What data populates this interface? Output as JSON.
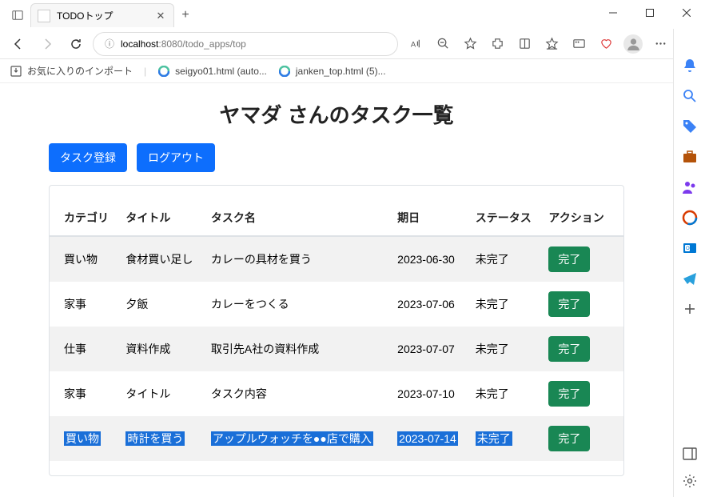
{
  "browser": {
    "tab_title": "TODOトップ",
    "url_host": "localhost",
    "url_port": ":8080",
    "url_path": "/todo_apps/top",
    "bookmarks": {
      "import": "お気に入りのインポート",
      "b1": "seigyo01.html (auto...",
      "b2": "janken_top.html (5)..."
    }
  },
  "page": {
    "title": "ヤマダ さんのタスク一覧",
    "register_btn": "タスク登録",
    "logout_btn": "ログアウト",
    "headers": {
      "category": "カテゴリ",
      "title": "タイトル",
      "task_name": "タスク名",
      "due": "期日",
      "status": "ステータス",
      "action": "アクション"
    },
    "complete_btn": "完了",
    "rows": [
      {
        "category": "買い物",
        "title": "食材買い足し",
        "name": "カレーの具材を買う",
        "due": "2023-06-30",
        "status": "未完了",
        "selected": false
      },
      {
        "category": "家事",
        "title": "夕飯",
        "name": "カレーをつくる",
        "due": "2023-07-06",
        "status": "未完了",
        "selected": false
      },
      {
        "category": "仕事",
        "title": "資料作成",
        "name": "取引先A社の資料作成",
        "due": "2023-07-07",
        "status": "未完了",
        "selected": false
      },
      {
        "category": "家事",
        "title": "タイトル",
        "name": "タスク内容",
        "due": "2023-07-10",
        "status": "未完了",
        "selected": false
      },
      {
        "category": "買い物",
        "title": "時計を買う",
        "name": "アップルウォッチを●●店で購入",
        "due": "2023-07-14",
        "status": "未完了",
        "selected": true
      }
    ]
  }
}
